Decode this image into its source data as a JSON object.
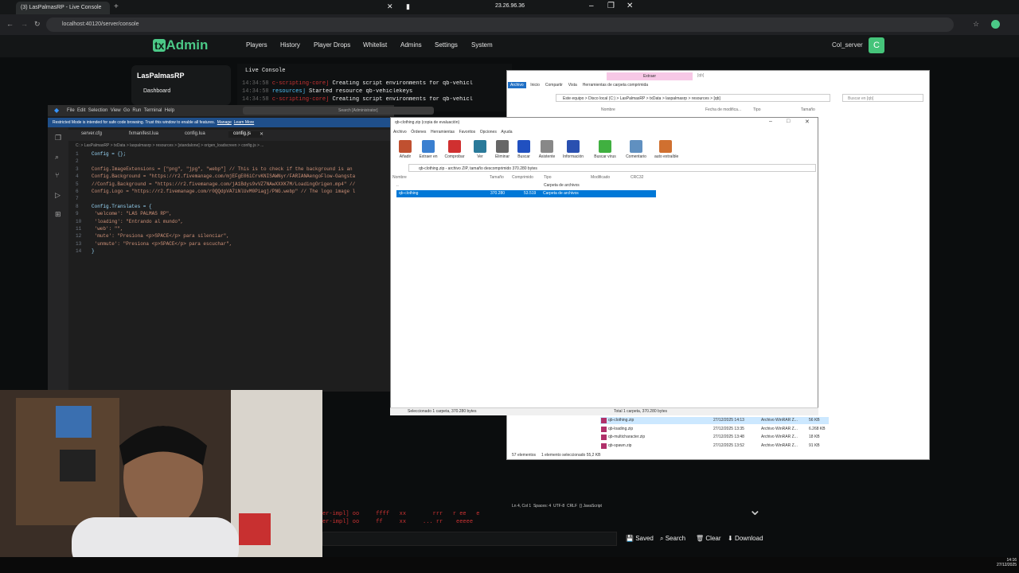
{
  "browser": {
    "tab_title": "(3) LasPalmasRP - Live Console",
    "ip_display": "23.26.96.36",
    "url": "localhost:40120/server/console"
  },
  "txadmin": {
    "logo_tx": "tx",
    "logo_admin": "Admin",
    "nav": [
      "Players",
      "History",
      "Player Drops",
      "Whitelist",
      "Admins",
      "Settings",
      "System"
    ],
    "server_name": "Col_server",
    "avatar_letter": "C",
    "sidebar_title": "LasPalmasRP",
    "sidebar_item": "Dashboard",
    "console_title": "Live Console",
    "console_lines": [
      {
        "time": "14:34:58",
        "tag": "c-scripting-core]",
        "msg": "Creating script environments for qb-vehicl"
      },
      {
        "time": "14:34:58",
        "tag": "resources]",
        "msg": "Started resource qb-vehiclekeys"
      },
      {
        "time": "14:34:58",
        "tag": "c-scripting-core]",
        "msg": "Creating script environments for qb-vehicl"
      }
    ],
    "bottom_lines": [
      "er-impl] oo     ffff   xx        rrr   r ee   e",
      "er-impl] oo     ff     xx     ... rr    eeeee"
    ],
    "buttons": {
      "saved": "Saved",
      "search": "Search",
      "clear": "Clear",
      "download": "Download"
    }
  },
  "vscode": {
    "menu": [
      "File",
      "Edit",
      "Selection",
      "View",
      "Go",
      "Run",
      "Terminal",
      "Help"
    ],
    "search": "Search [Administrator]",
    "warning": "Restricted Mode is intended for safe code browsing. Trust this window to enable all features.",
    "warning_manage": "Manage",
    "warning_learn": "Learn More",
    "tabs": [
      "server.cfg",
      "fxmanifest.lua",
      "config.lua",
      "config.js"
    ],
    "breadcrumb": "C: > LasPalmasRP > txData > laspalmasrp > resources > [standalone] > origen_loadscreen > config.js > ...",
    "code_lines": [
      {
        "n": "1",
        "t": "Config = {};"
      },
      {
        "n": "2",
        "t": ""
      },
      {
        "n": "3",
        "t": "Config.ImageExtensions = [\"png\", \"jpg\", \"webp\"] // This is to check if the background is an"
      },
      {
        "n": "4",
        "t": "Config.Background = \"https://r2.fivemanage.com/mjEFgE06iCrvKNISAWNyr/FARIANAengoFlow-Gangsta"
      },
      {
        "n": "5",
        "t": "//Config.Background = \"https://r2.fivemanage.com/jA1Bdys9vVZ7NAwXXXK7M/LoadingOrigen.mp4\" //"
      },
      {
        "n": "6",
        "t": "Config.Logo = \"https://r2.fivemanage.com/r0QQdpVA7iNlUvM0Piagj/PNG.webp\" // The logo image l"
      },
      {
        "n": "7",
        "t": ""
      },
      {
        "n": "8",
        "t": "Config.Translates = {"
      },
      {
        "n": "9",
        "t": "    'welcome': \"LAS PALMAS RP\","
      },
      {
        "n": "10",
        "t": "    'loading': \"Entrando al mundo\","
      },
      {
        "n": "11",
        "t": "    'web': \"\","
      },
      {
        "n": "12",
        "t": "    'mute': \"Presiona <p>SPACE</p> para silenciar\","
      },
      {
        "n": "13",
        "t": "    'unmute': \"Presiona <p>SPACE</p> para escuchar\","
      },
      {
        "n": "14",
        "t": "}"
      }
    ],
    "status": [
      "Ln 4, Col 1",
      "Spaces: 4",
      "UTF-8",
      "CRLF",
      "{} JavaScript"
    ]
  },
  "explorer": {
    "ribbon_tabs": [
      "Archivo",
      "Inicio",
      "Compartir",
      "Vista",
      "Herramientas de carpeta comprimida"
    ],
    "extract_tab": "Extraer",
    "folder_tab": "[qb]",
    "path": "Este equipo > Disco local (C:) > LasPalmasRP > txData > laspalmasrp > resources > [qb]",
    "search_placeholder": "Buscar en [qb]",
    "columns": [
      "Nombre",
      "Fecha de modifica...",
      "Tipo",
      "Tamaño"
    ],
    "files": [
      {
        "name": "qb-clothing.zip",
        "date": "27/12/2025 14:13",
        "type": "Archivo WinRAR Z...",
        "size": "56 KB"
      },
      {
        "name": "qb-loading.zip",
        "date": "27/12/2025 13:35",
        "type": "Archivo WinRAR Z...",
        "size": "6.268 KB"
      },
      {
        "name": "qb-multicharacter.zip",
        "date": "27/12/2025 13:48",
        "type": "Archivo WinRAR Z...",
        "size": "18 KB"
      },
      {
        "name": "qb-spawn.zip",
        "date": "27/12/2025 13:52",
        "type": "Archivo WinRAR Z...",
        "size": "91 KB"
      }
    ],
    "status_count": "57 elementos",
    "status_selected": "1 elemento seleccionado  55,2 KB"
  },
  "winrar": {
    "title": "qb-clothing.zip (copia de evaluación)",
    "menu": [
      "Archivo",
      "Órdenes",
      "Herramientas",
      "Favoritos",
      "Opciones",
      "Ayuda"
    ],
    "toolbar": [
      "Añadir",
      "Extraer en",
      "Comprobar",
      "Ver",
      "Eliminar",
      "Buscar",
      "Asistente",
      "Información",
      "Buscar virus",
      "Comentario",
      "auto extraíble"
    ],
    "path": "qb-clothing.zip - archivo ZIP, tamaño descomprimido 370.280 bytes",
    "columns": [
      "Nombre",
      "Tamaño",
      "Comprimido",
      "Tipo",
      "Modificado",
      "CRC32"
    ],
    "parent_row": {
      "name": "..",
      "type": "Carpeta de archivos"
    },
    "row": {
      "name": "qb-clothing",
      "size": "370.280",
      "packed": "53.519",
      "type": "Carpeta de archivos"
    },
    "status_left": "Seleccionado 1 carpeta, 370.280 bytes",
    "status_right": "Total 1 carpeta, 370.280 bytes"
  },
  "taskbar": {
    "time": "14:16",
    "date": "27/12/2025"
  },
  "colors": {
    "accent": "#4bc987",
    "selection": "#0078d7"
  }
}
